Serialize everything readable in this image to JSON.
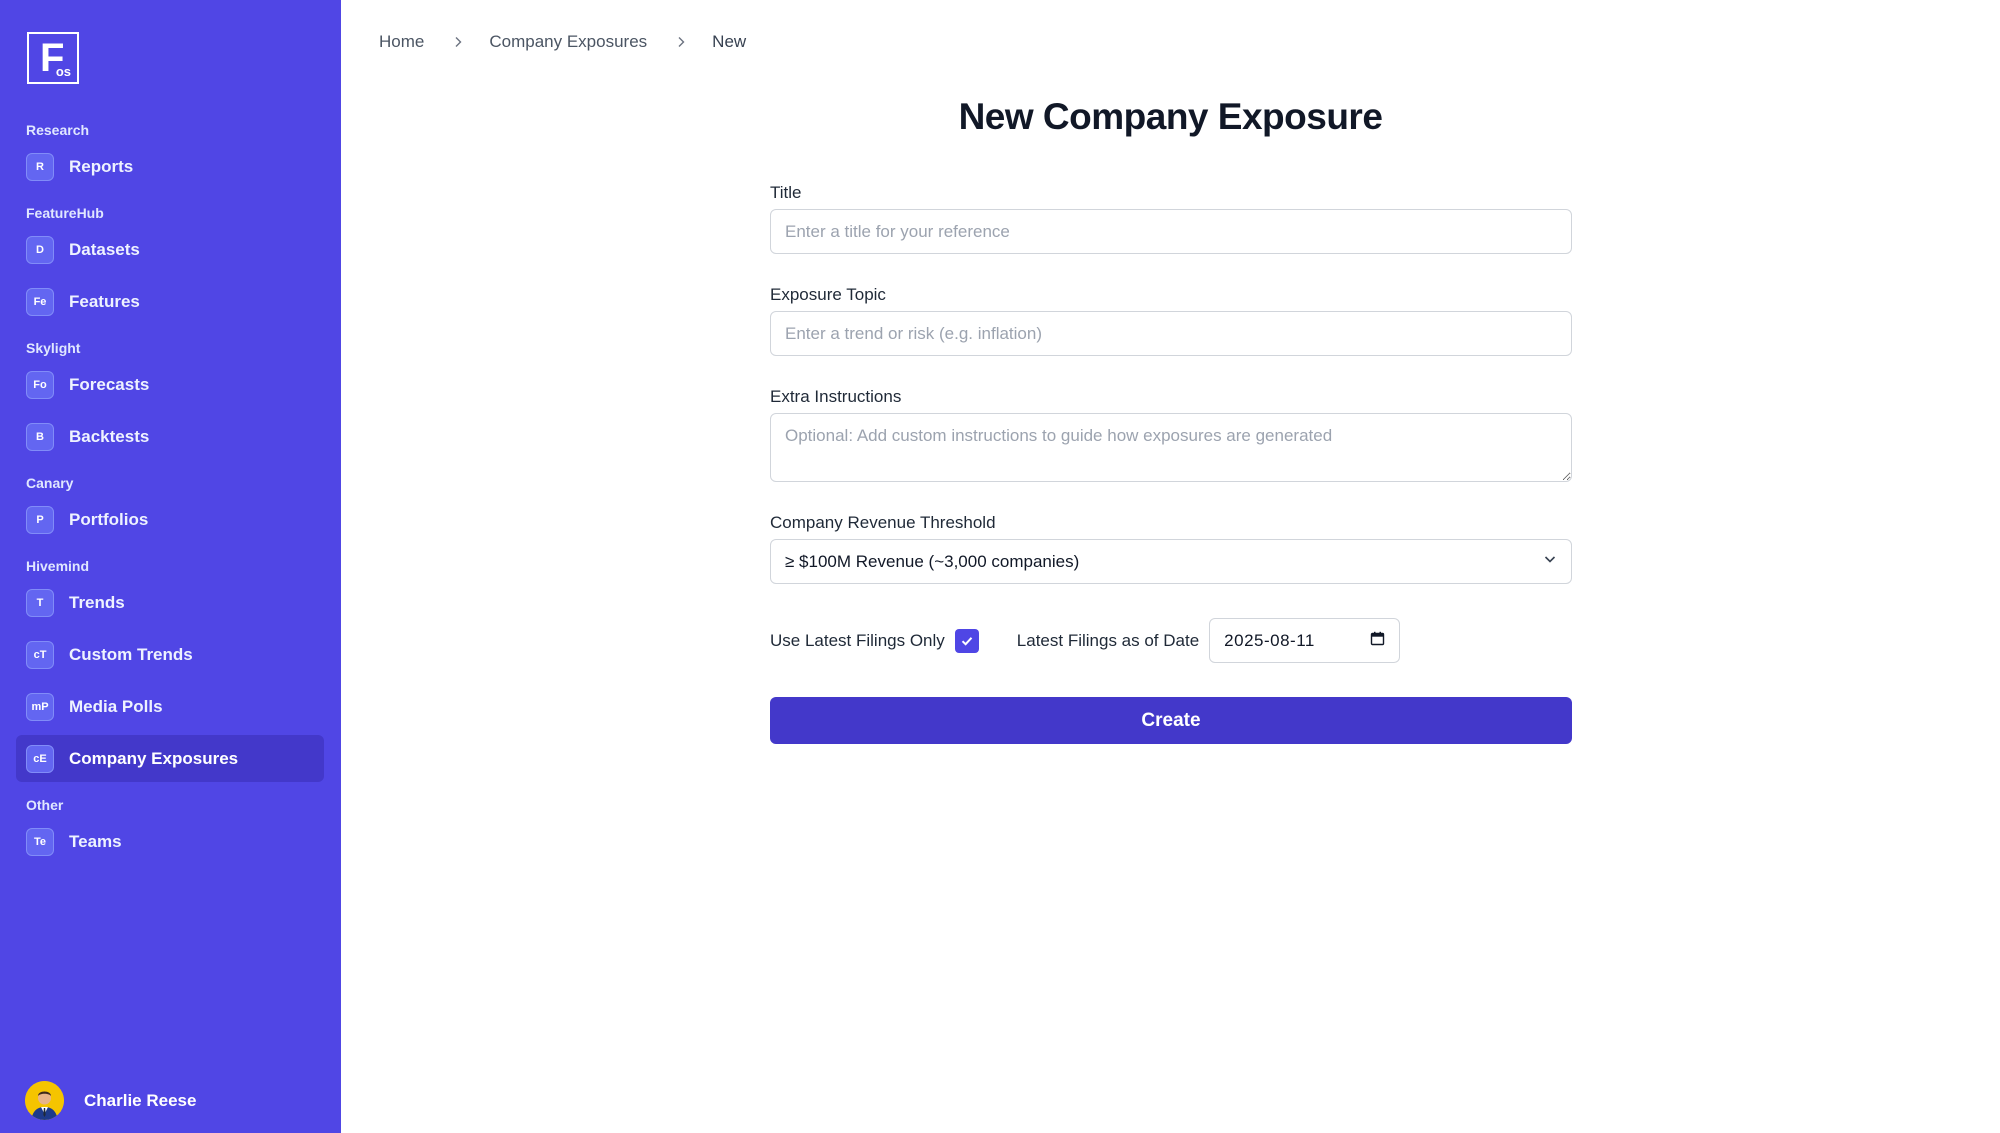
{
  "app": {
    "logo_letter": "F",
    "logo_sub": "os"
  },
  "sidebar": {
    "groups": [
      {
        "label": "Research",
        "items": [
          {
            "badge": "R",
            "label": "Reports"
          }
        ]
      },
      {
        "label": "FeatureHub",
        "items": [
          {
            "badge": "D",
            "label": "Datasets"
          },
          {
            "badge": "Fe",
            "label": "Features"
          }
        ]
      },
      {
        "label": "Skylight",
        "items": [
          {
            "badge": "Fo",
            "label": "Forecasts"
          },
          {
            "badge": "B",
            "label": "Backtests"
          }
        ]
      },
      {
        "label": "Canary",
        "items": [
          {
            "badge": "P",
            "label": "Portfolios"
          }
        ]
      },
      {
        "label": "Hivemind",
        "items": [
          {
            "badge": "T",
            "label": "Trends"
          },
          {
            "badge": "cT",
            "label": "Custom Trends"
          },
          {
            "badge": "mP",
            "label": "Media Polls"
          },
          {
            "badge": "cE",
            "label": "Company Exposures"
          }
        ]
      },
      {
        "label": "Other",
        "items": [
          {
            "badge": "Te",
            "label": "Teams"
          }
        ]
      }
    ],
    "active_item": "Company Exposures"
  },
  "user": {
    "name": "Charlie Reese"
  },
  "breadcrumb": [
    "Home",
    "Company Exposures",
    "New"
  ],
  "page": {
    "title": "New Company Exposure"
  },
  "form": {
    "title": {
      "label": "Title",
      "value": "",
      "placeholder": "Enter a title for your reference"
    },
    "topic": {
      "label": "Exposure Topic",
      "value": "",
      "placeholder": "Enter a trend or risk (e.g. inflation)"
    },
    "instructions": {
      "label": "Extra Instructions",
      "value": "",
      "placeholder": "Optional: Add custom instructions to guide how exposures are generated"
    },
    "revenue": {
      "label": "Company Revenue Threshold",
      "selected": "≥ $100M Revenue (~3,000 companies)"
    },
    "latest_filings": {
      "label": "Use Latest Filings Only",
      "checked": true
    },
    "filings_date": {
      "label": "Latest Filings as of Date",
      "value": "2025-08-11"
    },
    "submit_label": "Create"
  },
  "colors": {
    "sidebar_bg": "#5046e5",
    "active_item_bg": "#4338ca",
    "primary_button": "#4338ca",
    "checkbox": "#4f46e5"
  },
  "icons": {
    "breadcrumb_separator": "chevron-right-icon",
    "select_arrow": "chevron-down-icon",
    "checkbox_mark": "check-icon",
    "date_picker": "calendar-icon"
  }
}
